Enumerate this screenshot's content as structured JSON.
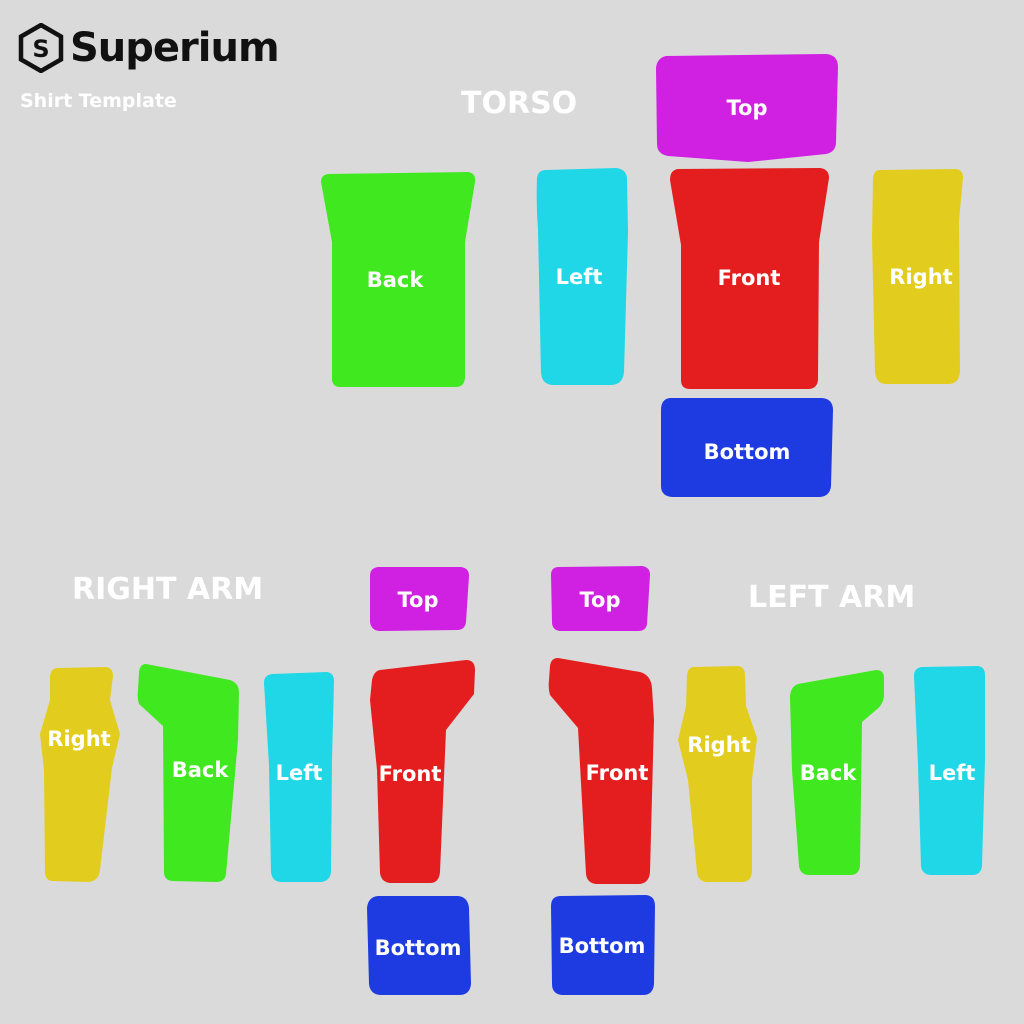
{
  "brand": {
    "name": "Superium",
    "logo_letter": "S"
  },
  "subtitle": "Shirt Template",
  "sections": {
    "torso": "TORSO",
    "right_arm": "RIGHT ARM",
    "left_arm": "LEFT ARM"
  },
  "colors": {
    "background": "#dadada",
    "top": "#d020e2",
    "bottom": "#1e3be2",
    "front": "#e41e1e",
    "back": "#40e820",
    "left": "#1fd7e6",
    "right": "#e2cd1e"
  },
  "torso": {
    "top": "Top",
    "back": "Back",
    "left": "Left",
    "front": "Front",
    "right": "Right",
    "bottom": "Bottom"
  },
  "right_arm": {
    "right": "Right",
    "back": "Back",
    "left": "Left",
    "top": "Top",
    "front": "Front",
    "bottom": "Bottom"
  },
  "left_arm": {
    "top": "Top",
    "front": "Front",
    "right": "Right",
    "back": "Back",
    "left": "Left",
    "bottom": "Bottom"
  }
}
